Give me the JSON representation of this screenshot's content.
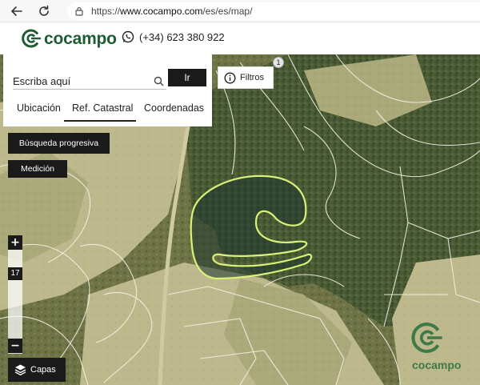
{
  "browser": {
    "url_prefix": "https://",
    "url_domain": "www.cocampo.com",
    "url_path": "/es/es/map/"
  },
  "header": {
    "brand": "cocampo",
    "phone": "(+34) 623 380 922"
  },
  "search": {
    "placeholder": "Escriba aquí",
    "go_label": "Ir"
  },
  "tabs": [
    {
      "label": "Ubicación",
      "active": false
    },
    {
      "label": "Ref. Catastral",
      "active": true
    },
    {
      "label": "Coordenadas",
      "active": false
    }
  ],
  "filters": {
    "label": "Filtros",
    "badge": "1"
  },
  "tools": {
    "progressive_search": "Búsqueda progresiva",
    "measure": "Medición"
  },
  "zoom": {
    "in": "+",
    "out": "−",
    "level": "17"
  },
  "layers": {
    "label": "Capas"
  },
  "watermark": {
    "text": "cocampo"
  },
  "colors": {
    "brand_green": "#1f5c33",
    "parcel_highlight": "#d9f07a",
    "button_dark": "#1a1a1a"
  }
}
